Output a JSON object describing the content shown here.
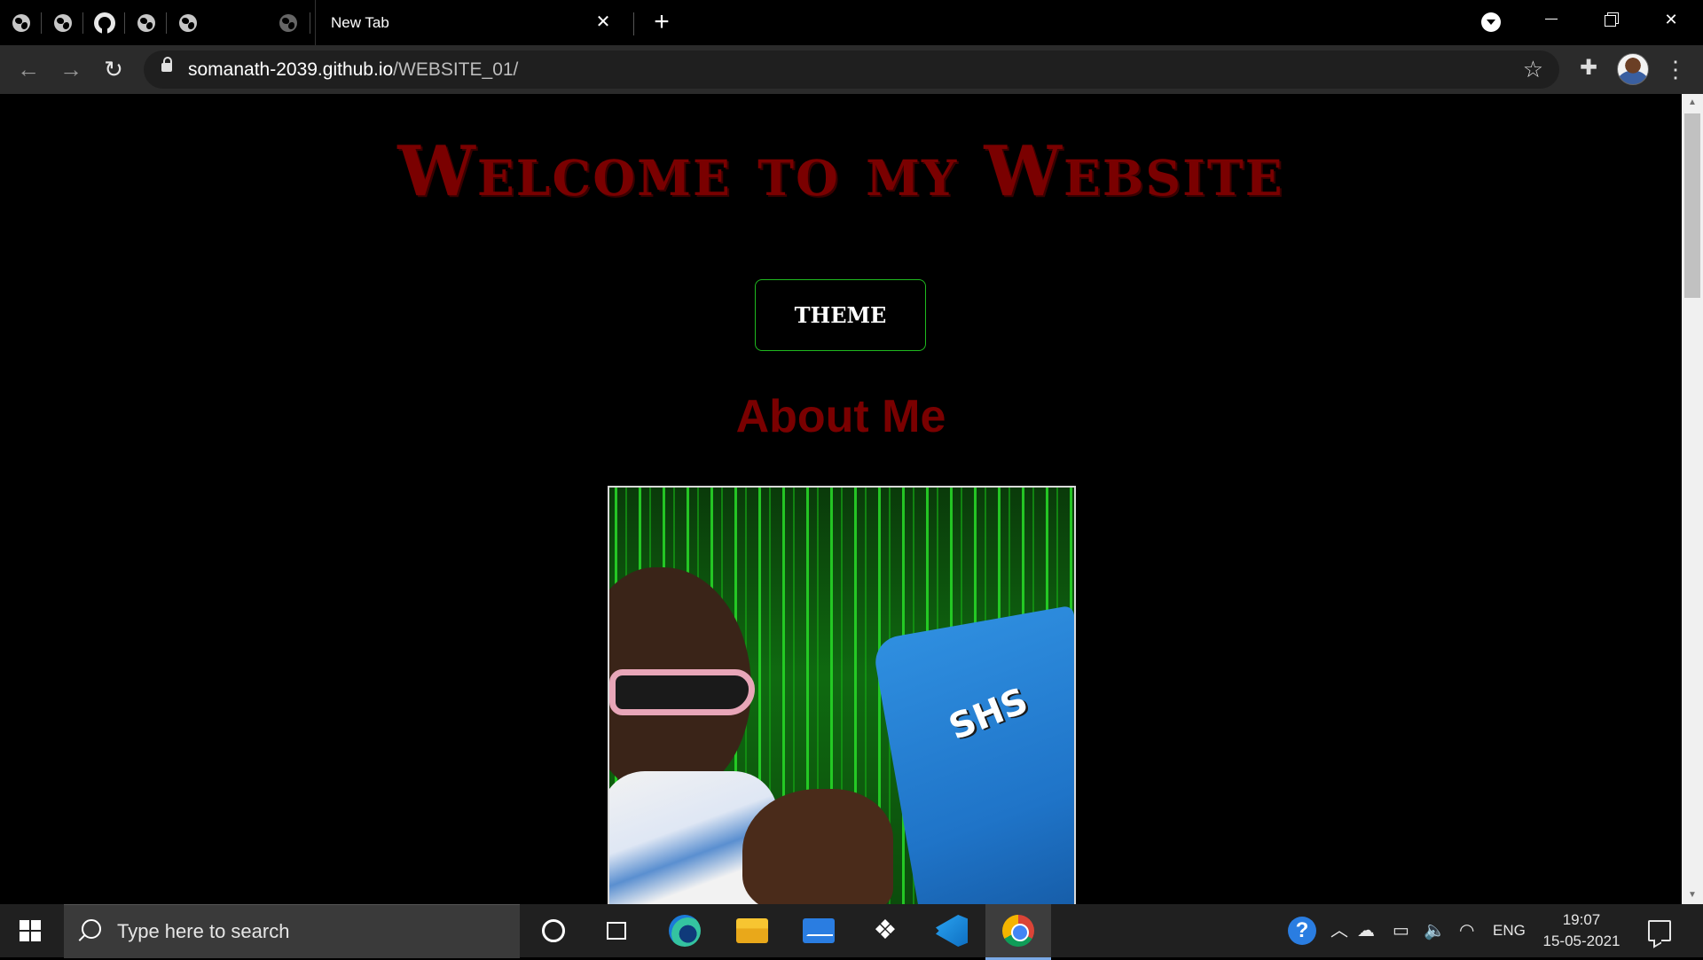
{
  "browser": {
    "active_tab_title": "New Tab",
    "url_host": "somanath-2039.github.io",
    "url_path": "/WEBSITE_01/",
    "pinned_tabs": [
      {
        "icon": "globe-icon"
      },
      {
        "icon": "globe-icon"
      },
      {
        "icon": "github-icon"
      },
      {
        "icon": "globe-icon"
      },
      {
        "icon": "globe-icon"
      }
    ]
  },
  "page": {
    "heading": "Welcome to my Website",
    "theme_button": "THEME",
    "about_heading": "About Me",
    "photo_logo_text": "SHS",
    "colors": {
      "heading": "#7a0000",
      "button_border": "#1fb81f",
      "background": "#000000"
    }
  },
  "taskbar": {
    "search_placeholder": "Type here to search",
    "language": "ENG",
    "time": "19:07",
    "date": "15-05-2021",
    "help_glyph": "?"
  }
}
